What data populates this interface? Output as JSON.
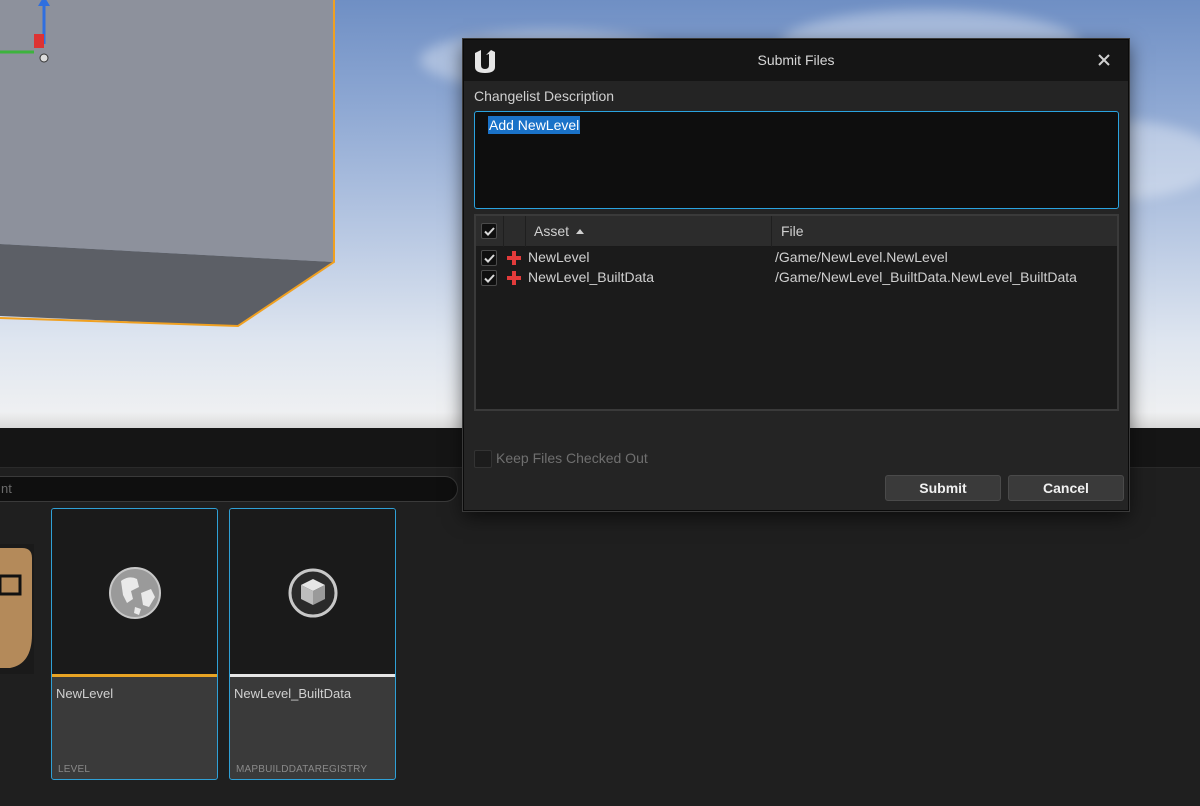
{
  "dialog": {
    "title": "Submit Files",
    "close_icon": "close-icon",
    "logo_icon": "unreal-logo-icon",
    "description_label": "Changelist Description",
    "description_value": "Add NewLevel",
    "table": {
      "columns": {
        "asset": "Asset",
        "file": "File"
      },
      "sort_column": "Asset",
      "sort_direction": "ascending",
      "all_checked": true,
      "rows": [
        {
          "checked": true,
          "status_icon": "add-plus-icon",
          "asset": "NewLevel",
          "file": "/Game/NewLevel.NewLevel"
        },
        {
          "checked": true,
          "status_icon": "add-plus-icon",
          "asset": "NewLevel_BuiltData",
          "file": "/Game/NewLevel_BuiltData.NewLevel_BuiltData"
        }
      ]
    },
    "keep_checked_out_label": "Keep Files Checked Out",
    "keep_checked_out": false,
    "submit_label": "Submit",
    "cancel_label": "Cancel",
    "accent_color": "#2aa3e0",
    "selection_color": "#1a72c8",
    "add_icon_color": "#e23b3b"
  },
  "content_browser": {
    "search_placeholder": "nt",
    "tiles": [
      {
        "name": "NewLevel",
        "type": "LEVEL",
        "icon": "globe-icon",
        "bar_color": "#e8a424"
      },
      {
        "name": "NewLevel_BuiltData",
        "type": "MAPBUILDDATAREGISTRY",
        "icon": "cube-icon",
        "bar_color": "#e6e6e6"
      }
    ]
  },
  "viewport": {
    "selection_outline_color": "#f0a020"
  }
}
